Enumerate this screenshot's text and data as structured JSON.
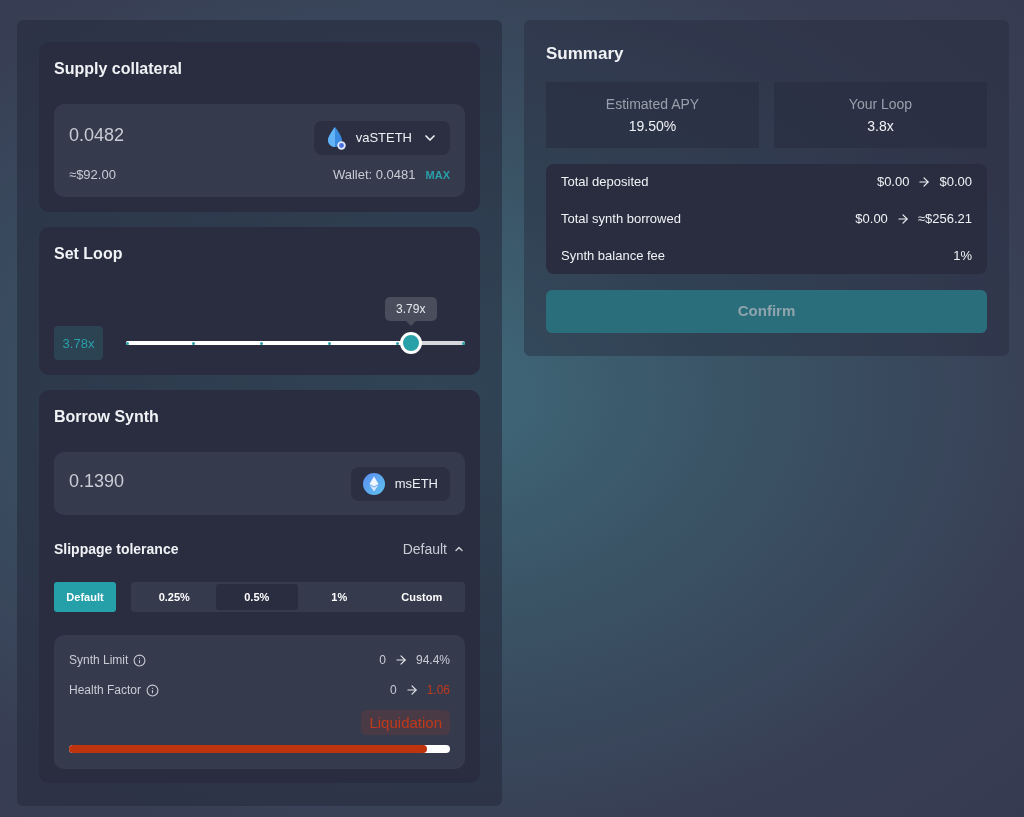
{
  "supply": {
    "title": "Supply collateral",
    "amount": "0.0482",
    "token": "vaSTETH",
    "token_dropdown": true,
    "usd": "≈$92.00",
    "wallet": "Wallet: 0.0481",
    "max": "MAX"
  },
  "loop": {
    "title": "Set Loop",
    "value": "3.78x",
    "tooltip": "3.79x",
    "level": 0.84
  },
  "borrow": {
    "title": "Borrow Synth",
    "amount": "0.1390",
    "token": "msETH",
    "token_dropdown": false
  },
  "slippage": {
    "title": "Slippage tolerance",
    "current": "Default",
    "expanded": true,
    "options": [
      {
        "label": "Default",
        "kind": "preset",
        "selected": true,
        "highlighted": false
      },
      {
        "label": "0.25%",
        "kind": "segment",
        "selected": false,
        "highlighted": false
      },
      {
        "label": "0.5%",
        "kind": "segment",
        "selected": false,
        "highlighted": true
      },
      {
        "label": "1%",
        "kind": "segment",
        "selected": false,
        "highlighted": false
      },
      {
        "label": "Custom",
        "kind": "segment",
        "selected": false,
        "highlighted": false
      }
    ]
  },
  "risk": {
    "rows": [
      {
        "label": "Synth Limit",
        "from": "0",
        "to": "94.4%",
        "warning": false
      },
      {
        "label": "Health Factor",
        "from": "0",
        "to": "1.06",
        "warning": true
      }
    ],
    "badge": "Liquidation",
    "level": 0.94
  },
  "summary": {
    "title": "Summary",
    "stats": [
      {
        "label": "Estimated APY",
        "value": "19.50%"
      },
      {
        "label": "Your Loop",
        "value": "3.8x"
      }
    ],
    "rows": [
      {
        "label": "Total deposited",
        "kind": "change",
        "from": "$0.00",
        "to": "$0.00"
      },
      {
        "label": "Total synth borrowed",
        "kind": "change",
        "from": "$0.00",
        "to": "≈$256.21"
      },
      {
        "label": "Synth balance fee",
        "kind": "plain",
        "value": "1%"
      }
    ],
    "confirm": {
      "label": "Confirm",
      "disabled": true
    }
  }
}
